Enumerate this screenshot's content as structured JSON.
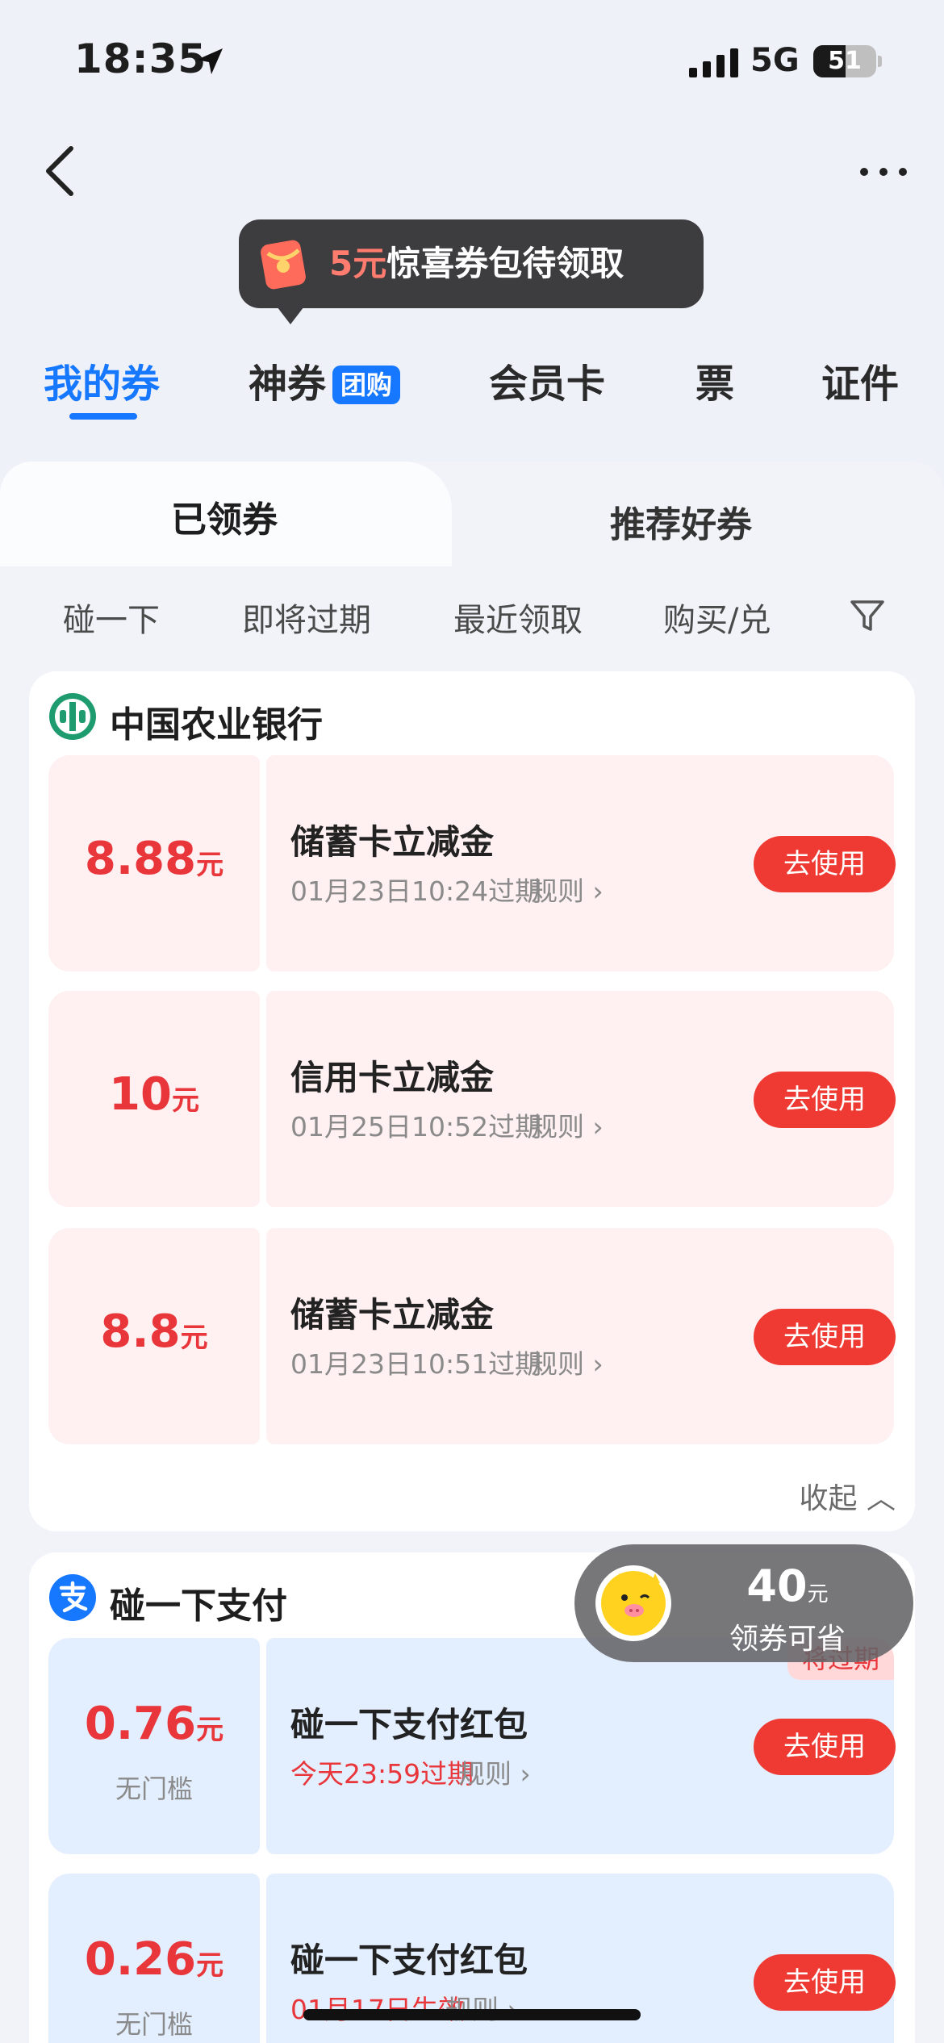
{
  "status_bar": {
    "time": "18:35",
    "network": "5G",
    "battery": "51",
    "battery_level": 0.51
  },
  "promo": {
    "amount": "5元",
    "text": "惊喜券包待领取"
  },
  "top_tabs": [
    {
      "label": "我的券",
      "active": true
    },
    {
      "label": "神券",
      "badge": "团购",
      "active": false
    },
    {
      "label": "会员卡",
      "active": false
    },
    {
      "label": "票",
      "active": false
    },
    {
      "label": "证件",
      "active": false
    }
  ],
  "panel_tabs": [
    {
      "label": "已领券",
      "active": true
    },
    {
      "label": "推荐好券",
      "active": false
    }
  ],
  "filters": [
    "碰一下",
    "即将过期",
    "最近领取",
    "购买/兑"
  ],
  "groups": [
    {
      "title": "中国农业银行",
      "coupons": [
        {
          "amount": "8.88",
          "unit": "元",
          "name": "储蓄卡立减金",
          "expiry": "01月23日10:24过期",
          "rule": "规则 ›",
          "action": "去使用"
        },
        {
          "amount": "10",
          "unit": "元",
          "name": "信用卡立减金",
          "expiry": "01月25日10:52过期",
          "rule": "规则 ›",
          "action": "去使用"
        },
        {
          "amount": "8.8",
          "unit": "元",
          "name": "储蓄卡立减金",
          "expiry": "01月23日10:51过期",
          "rule": "规则 ›",
          "action": "去使用"
        }
      ],
      "collapse": "收起 ︿"
    },
    {
      "title": "碰一下支付",
      "coupons": [
        {
          "amount": "0.76",
          "unit": "元",
          "threshold": "无门槛",
          "name": "碰一下支付红包",
          "expiry": "今天23:59过期",
          "rule": "规则 ›",
          "action": "去使用",
          "tag": "将过期"
        },
        {
          "amount": "0.26",
          "unit": "元",
          "threshold": "无门槛",
          "name": "碰一下支付红包",
          "expiry": "01月17日生效",
          "rule": "规则 ›",
          "action": "去使用"
        }
      ]
    }
  ],
  "savings": {
    "amount": "40",
    "unit": "元",
    "label": "领券可省"
  },
  "colors": {
    "accent": "#1677ff",
    "coupon_red": "#e8363b",
    "button_red": "#ee3a33"
  }
}
